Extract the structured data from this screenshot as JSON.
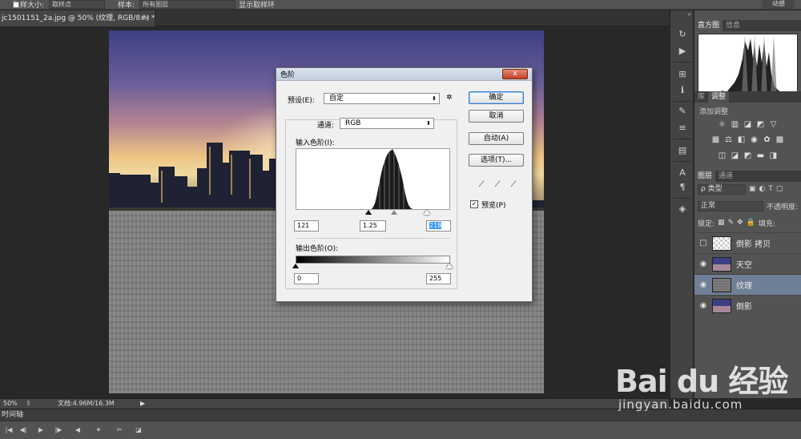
{
  "options_bar": {
    "sample_size_label": "取样大小:",
    "sample_size_value": "取样点",
    "sample_label": "样本:",
    "sample_value": "所有图层",
    "show_ring_label": "显示取样环",
    "motion_label": "动感"
  },
  "document": {
    "tab_title": "jc1501151_2a.jpg @ 50% (纹理, RGB/8#) *",
    "close_glyph": "×"
  },
  "status_bar": {
    "zoom": "50%",
    "doc_size": "文档:4.96M/16.3M",
    "arrow": "▶"
  },
  "timeline": {
    "label": "时间轴"
  },
  "panels": {
    "top_tabs": [
      "直方图",
      "信息"
    ],
    "adjust_tabs": [
      "库",
      "调整"
    ],
    "adjust_hint": "添加调整",
    "layer_tabs": [
      "图层",
      "通道"
    ],
    "filter_kind": "ρ 类型",
    "blend_mode": "正常",
    "opacity_label": "不透明度:",
    "lock_label": "锁定:",
    "fill_label": "填充:",
    "layers": [
      {
        "name": "倒影 拷贝",
        "visible": false,
        "selected": false
      },
      {
        "name": "天空",
        "visible": true,
        "selected": false
      },
      {
        "name": "纹理",
        "visible": true,
        "selected": true
      },
      {
        "name": "倒影",
        "visible": true,
        "selected": false
      }
    ]
  },
  "dialog": {
    "title": "色阶",
    "close_glyph": "x",
    "preset_label": "预设(E):",
    "preset_value": "自定",
    "channel_label": "通道:",
    "channel_value": "RGB",
    "input_label": "输入色阶(I):",
    "input_black": "121",
    "input_gamma": "1.25",
    "input_white": "218",
    "output_label": "输出色阶(O):",
    "output_black": "0",
    "output_white": "255",
    "buttons": {
      "ok": "确定",
      "cancel": "取消",
      "auto": "自动(A)",
      "options": "选项(T)..."
    },
    "preview_label": "预览(P)",
    "preview_checked": true
  },
  "watermark": {
    "logo": "Bai du 经验",
    "url": "jingyan.baidu.com"
  },
  "colors": {
    "selected_layer": "#6e7f96",
    "dialog_bg": "#f0f0f0",
    "close_button": "#c24327"
  }
}
